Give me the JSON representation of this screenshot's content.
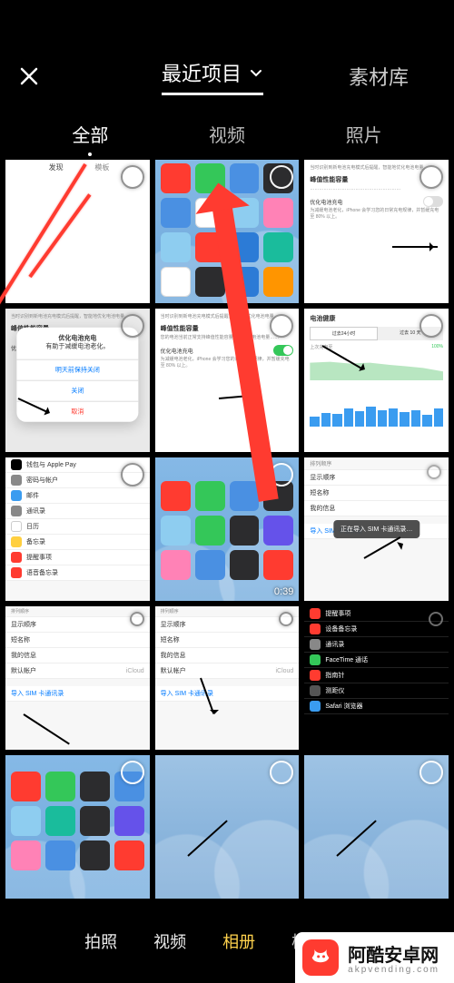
{
  "header": {
    "close_icon": "close-icon",
    "title": "最近项目",
    "library": "素材库"
  },
  "subtabs": {
    "items": [
      "全部",
      "视频",
      "照片"
    ],
    "active_index": 0
  },
  "settings_labels": {
    "peak_capacity": "峰值性能容量",
    "optimized_charging": "优化电池充电",
    "last24h": "过去24小时",
    "last10d": "过去 10 天",
    "battery_health": "电池健康",
    "last_charge": "上次充电至",
    "percent_100": "100%"
  },
  "dialog": {
    "title": "优化电池充电",
    "msg": "有助于减缓电池老化。",
    "keep_off": "明天前保持关闭",
    "close": "关闭",
    "cancel": "取消"
  },
  "list_a": {
    "items": [
      "钱包与 Apple Pay",
      "密码与帐户",
      "邮件",
      "通讯录",
      "日历",
      "备忘录",
      "提醒事项",
      "语音备忘录"
    ]
  },
  "list_b": {
    "items": [
      "显示顺序",
      "短名称",
      "我的信息",
      "默认帐户",
      "导入 SIM 卡通讯录"
    ],
    "default_val": "iCloud"
  },
  "list_c": {
    "importing": "正在导入 SIM 卡通讯录…",
    "import_label": "导入 SIM 卡通讯录"
  },
  "list_d": {
    "items": [
      "设备备忘录",
      "通讯录",
      "FaceTime 通话",
      "指南针",
      "测距仪",
      "Safari 浏览器"
    ],
    "title": "提醒事项"
  },
  "duration": "0:39",
  "bottom": {
    "items": [
      "拍照",
      "视频",
      "相册",
      "模板拍摄"
    ],
    "active_index": 2
  },
  "watermark": {
    "name": "阿酷安卓网",
    "domain": "akpvending.com"
  }
}
